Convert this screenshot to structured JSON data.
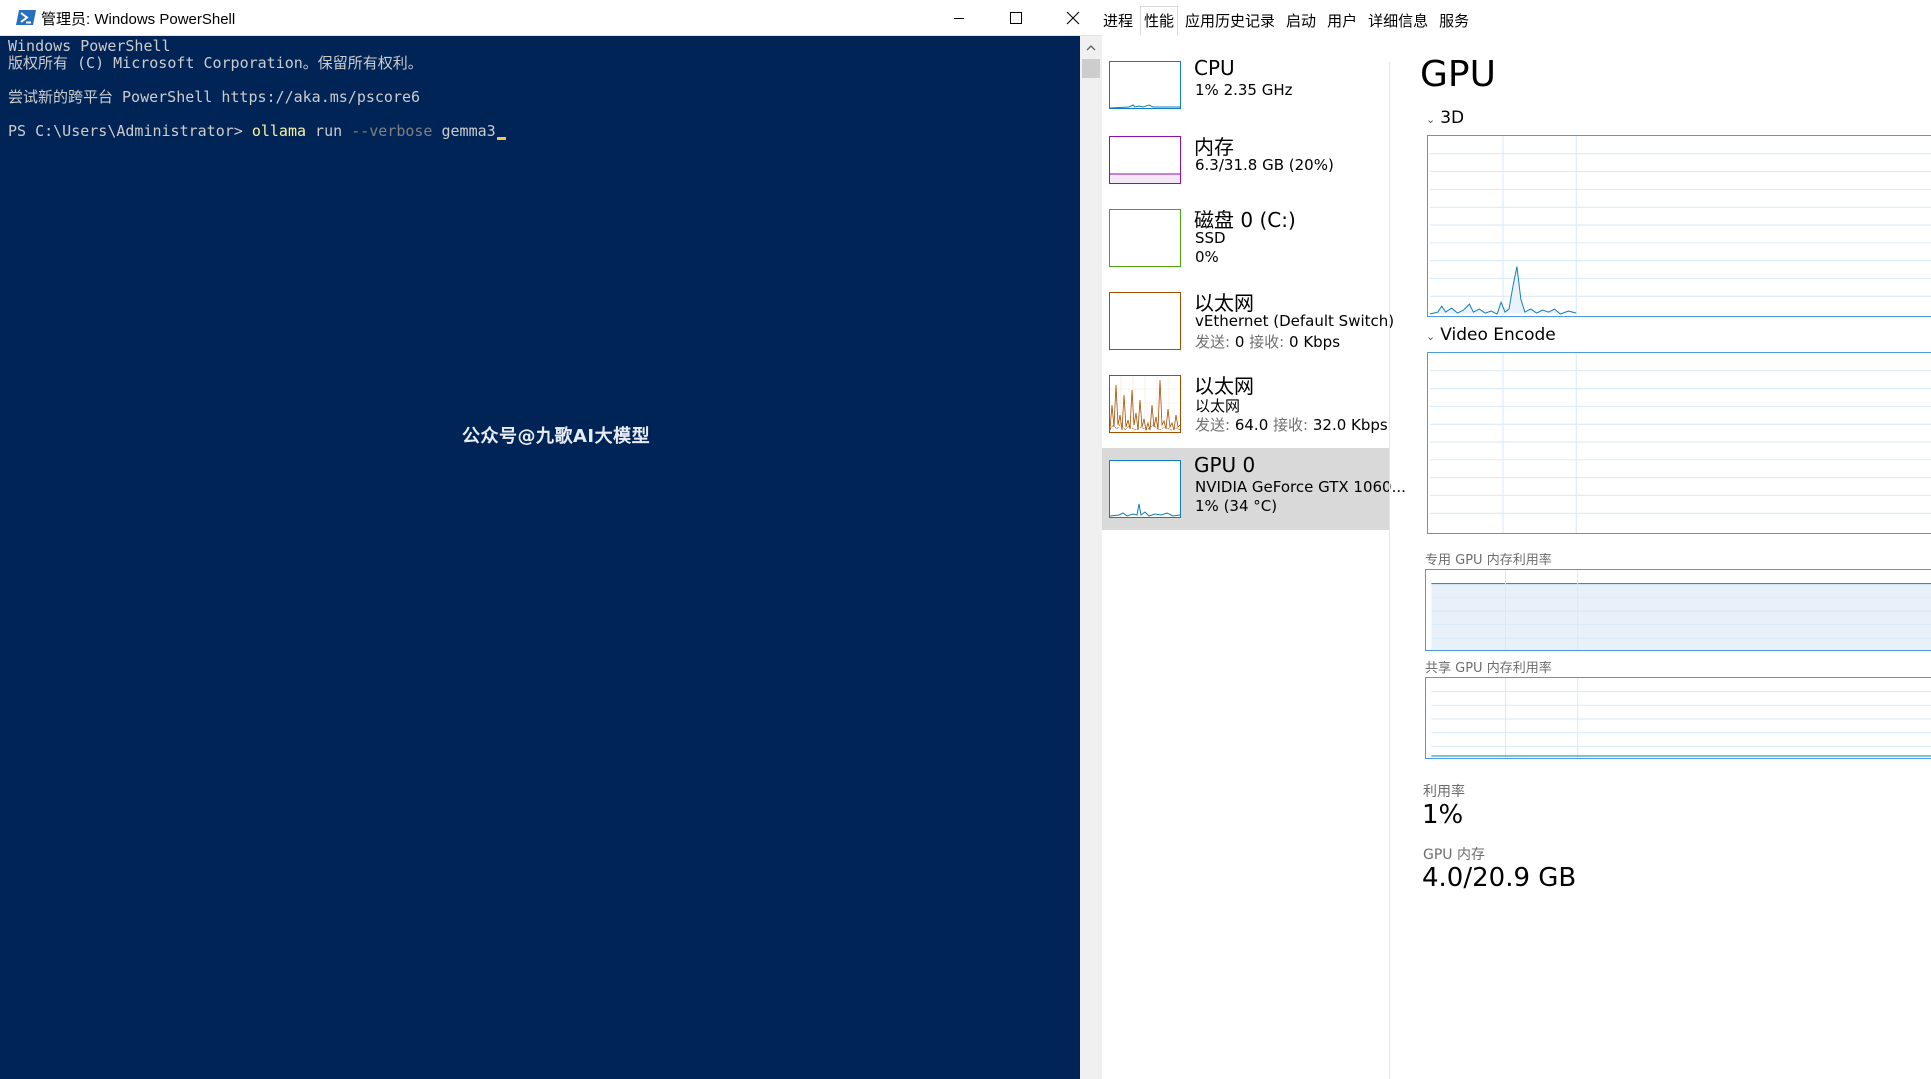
{
  "powershell": {
    "title": "管理员: Windows PowerShell",
    "lines": {
      "l1": "Windows PowerShell",
      "l2": "版权所有 (C) Microsoft Corporation。保留所有权利。",
      "l3": "尝试新的跨平台 PowerShell https://aka.ms/pscore6",
      "prompt": "PS C:\\Users\\Administrator> ",
      "cmd": "ollama",
      "arg1": " run ",
      "param": "--verbose",
      "arg2": " gemma3"
    },
    "watermark": "公众号@九歌AI大模型"
  },
  "taskmanager": {
    "tabs": [
      "进程",
      "性能",
      "应用历史记录",
      "启动",
      "用户",
      "详细信息",
      "服务"
    ],
    "active_tab": "性能",
    "resources": {
      "cpu": {
        "name": "CPU",
        "line1": "1%  2.35 GHz",
        "color": "#117dbb"
      },
      "memory": {
        "name": "内存",
        "line1": "6.3/31.8 GB (20%)",
        "color": "#8b12ae"
      },
      "disk": {
        "name": "磁盘 0 (C:)",
        "line1": "SSD",
        "line2": "0%",
        "color": "#4da60c"
      },
      "eth1": {
        "name": "以太网",
        "line1": "vEthernet (Default Switch)",
        "send_label": "发送:",
        "send_value": "0",
        "recv_label": "接收:",
        "recv_value": "0 Kbps",
        "color": "#a74f01"
      },
      "eth2": {
        "name": "以太网",
        "line1": "以太网",
        "send_label": "发送:",
        "send_value": "64.0",
        "recv_label": "接收:",
        "recv_value": "32.0 Kbps",
        "color": "#a74f01"
      },
      "gpu": {
        "name": "GPU 0",
        "line1": "NVIDIA GeForce GTX 1060...",
        "line2": "1%  (34 °C)",
        "color": "#117dbb"
      }
    },
    "detail": {
      "title": "GPU",
      "engine1": "3D",
      "engine2": "Video Encode",
      "dedicated_label": "专用 GPU 内存利用率",
      "shared_label": "共享 GPU 内存利用率",
      "util_label": "利用率",
      "util_value": "1%",
      "mem_label": "GPU 内存",
      "mem_value": "4.0/20.9 GB"
    }
  }
}
